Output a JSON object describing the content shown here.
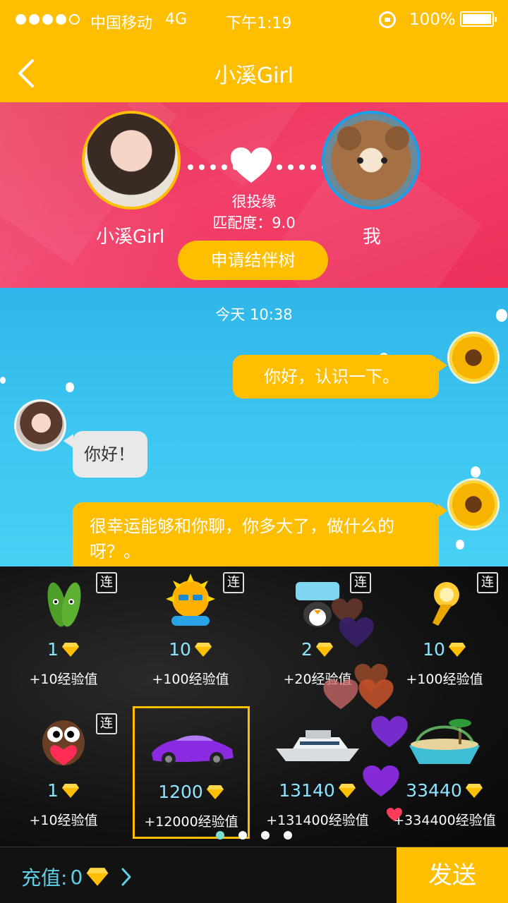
{
  "status_bar": {
    "carrier": "中国移动",
    "network": "4G",
    "time": "下午1:19",
    "battery": "100%",
    "signal_filled": 4,
    "signal_total": 5
  },
  "nav": {
    "title": "小溪Girl"
  },
  "match": {
    "her_name": "小溪Girl",
    "my_name": "我",
    "match_text": "很投缘",
    "match_score": "匹配度：9.0",
    "apply_button": "申请结伴树"
  },
  "chat": {
    "timestamp": "今天 10:38",
    "messages": [
      {
        "from": "me",
        "text": "你好，认识一下。"
      },
      {
        "from": "her",
        "text": "你好！"
      },
      {
        "from": "me",
        "text": "很幸运能够和你聊，你多大了，做什么的呀？。"
      }
    ]
  },
  "gifts": [
    {
      "name": "cucumber",
      "price": "1",
      "exp": "+10经验值",
      "combo": "连",
      "selected": false
    },
    {
      "name": "inke-boy-sun",
      "price": "10",
      "exp": "+100经验值",
      "combo": "连",
      "selected": false
    },
    {
      "name": "jiayou-penguin",
      "price": "2",
      "exp": "+20经验值",
      "combo": "连",
      "selected": false
    },
    {
      "name": "magic-lamp",
      "price": "10",
      "exp": "+100经验值",
      "combo": "连",
      "selected": false
    },
    {
      "name": "owl-heart",
      "price": "1",
      "exp": "+10经验值",
      "combo": "连",
      "selected": false
    },
    {
      "name": "sports-car",
      "price": "1200",
      "exp": "+12000经验值",
      "combo": "",
      "selected": true
    },
    {
      "name": "yacht",
      "price": "13140",
      "exp": "+131400经验值",
      "combo": "",
      "selected": false
    },
    {
      "name": "island",
      "price": "33440",
      "exp": "+334400经验值",
      "combo": "",
      "selected": false
    }
  ],
  "pager": {
    "pages": 4,
    "active": 0
  },
  "bottom": {
    "recharge_label": "充值:",
    "balance": "0",
    "send_label": "发送"
  },
  "colors": {
    "accent": "#ffbe00",
    "banner": "#ee2f5a",
    "chat_bg": "#3cc6f0",
    "price_text": "#8fe3ff"
  }
}
